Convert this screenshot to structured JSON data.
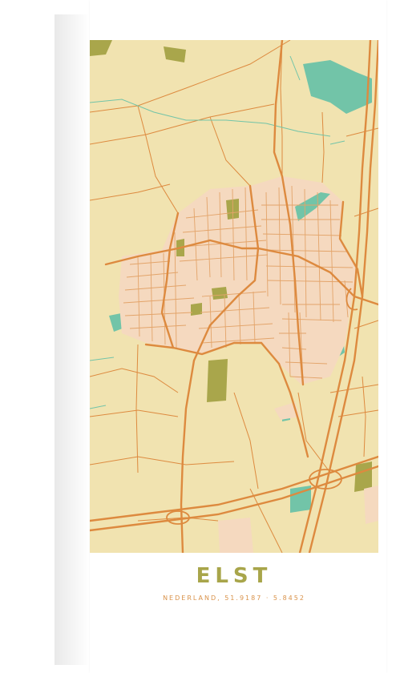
{
  "poster": {
    "city": "ELST",
    "subtitle": "NEDERLAND, 51.9187 · 5.8452"
  },
  "colors": {
    "land": "#f1e3b0",
    "road_major": "#dd8a3f",
    "road_minor": "#e3a46a",
    "water": "#72c4a8",
    "park": "#a9a64b",
    "built": "#f5d9bf",
    "title": "#a8a54a",
    "subtitle": "#d9924a"
  }
}
